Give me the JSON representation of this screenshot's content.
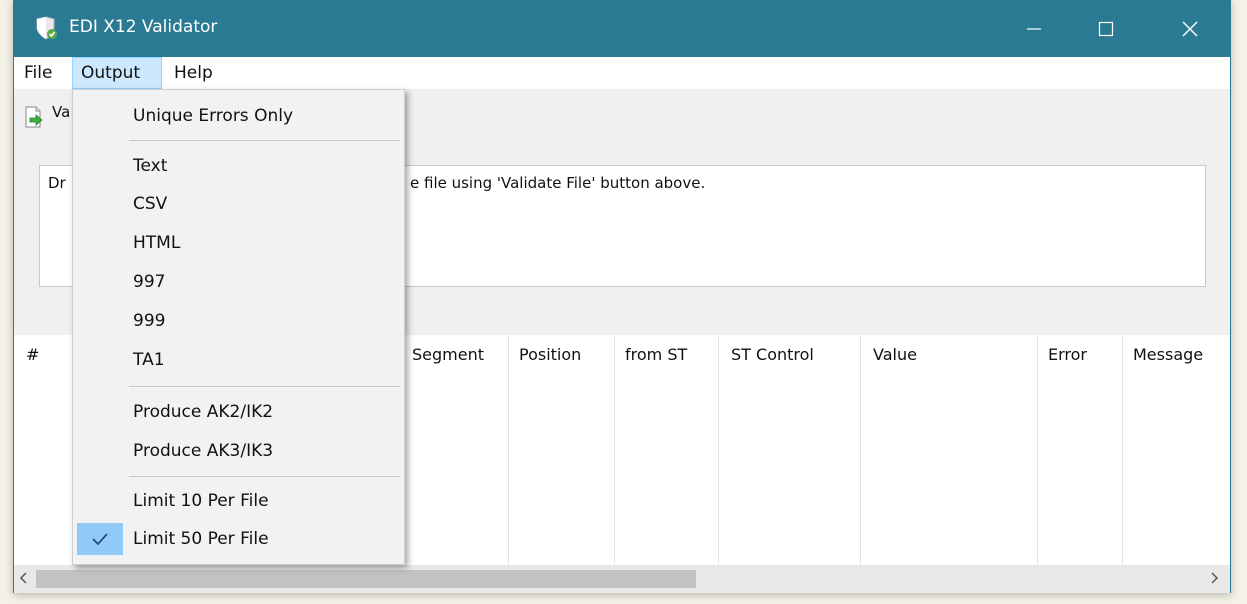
{
  "window": {
    "title": "EDI X12 Validator"
  },
  "menubar": {
    "file": "File",
    "output": "Output",
    "help": "Help"
  },
  "toolbar": {
    "validate_label_partial": "Va"
  },
  "drop_area": {
    "text_left": "Dr",
    "text_right": "e file using 'Validate File' button above."
  },
  "grid": {
    "columns": [
      "#",
      "Segment",
      "Position",
      "from ST",
      "ST Control",
      "Value",
      "Error",
      "Message"
    ]
  },
  "output_menu": {
    "items": [
      {
        "label": "Unique Errors Only",
        "checked": false
      },
      {
        "label": "Text",
        "checked": false
      },
      {
        "label": "CSV",
        "checked": false
      },
      {
        "label": "HTML",
        "checked": false
      },
      {
        "label": "997",
        "checked": false
      },
      {
        "label": "999",
        "checked": false
      },
      {
        "label": "TA1",
        "checked": false
      },
      {
        "label": "Produce AK2/IK2",
        "checked": false
      },
      {
        "label": "Produce AK3/IK3",
        "checked": false
      },
      {
        "label": "Limit 10 Per File",
        "checked": false
      },
      {
        "label": "Limit 50 Per File",
        "checked": true
      }
    ]
  },
  "icons": {
    "app": "shield-app-icon",
    "validate": "validate-file-icon",
    "check": "check-icon"
  },
  "colors": {
    "titlebar": "#2b7a94",
    "menu_highlight": "#cce8ff",
    "checked_item": "#91c9f7"
  }
}
